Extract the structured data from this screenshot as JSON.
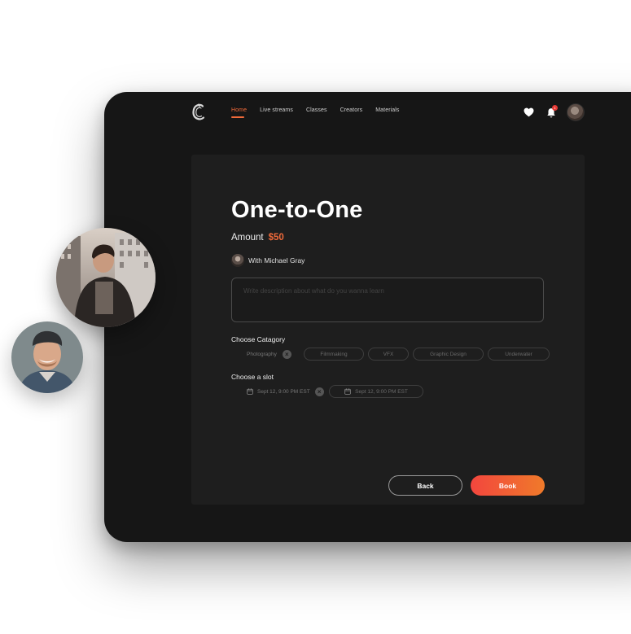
{
  "nav": {
    "items": [
      {
        "label": "Home",
        "active": true
      },
      {
        "label": "Live streams",
        "active": false
      },
      {
        "label": "Classes",
        "active": false
      },
      {
        "label": "Creators",
        "active": false
      },
      {
        "label": "Materials",
        "active": false
      }
    ],
    "notification_count": "1"
  },
  "page": {
    "title": "One-to-One",
    "amount_label": "Amount",
    "amount_value": "$50",
    "with_text": "With Michael Gray",
    "description_placeholder": "Write description about what do you wanna learn",
    "category_label": "Choose Catagory",
    "categories": [
      "Photography",
      "Filmmaking",
      "VFX",
      "Graphic Design",
      "Underwater"
    ],
    "selected_category": "Photography",
    "slot_label": "Choose a slot",
    "slots": [
      "Sept 12, 9:00 PM EST",
      "Sept 12, 9:00 PM EST"
    ],
    "back_label": "Back",
    "book_label": "Book"
  },
  "colors": {
    "accent": "#f06a3a",
    "book_gradient_start": "#f2463e",
    "book_gradient_end": "#f07a2a",
    "device_bg": "#161616",
    "panel_bg": "#1e1e1e"
  },
  "icons": {
    "logo": "brand-c-logo",
    "heart": "heart-icon",
    "bell": "bell-icon",
    "calendar": "calendar-icon",
    "remove": "close-icon"
  }
}
